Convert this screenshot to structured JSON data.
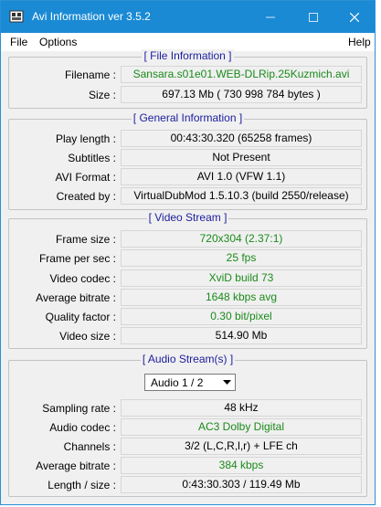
{
  "window": {
    "title": "Avi Information ver 3.5.2"
  },
  "menu": {
    "file": "File",
    "options": "Options",
    "help": "Help"
  },
  "file_info": {
    "title": "[ File Information ]",
    "rows": [
      {
        "label": "Filename :",
        "value": "Sansara.s01e01.WEB-DLRip.25Kuzmich.avi"
      },
      {
        "label": "Size :",
        "value": "697.13 Mb ( 730 998 784 bytes )"
      }
    ]
  },
  "general_info": {
    "title": "[ General Information ]",
    "rows": [
      {
        "label": "Play length :",
        "value": "00:43:30.320 (65258 frames)"
      },
      {
        "label": "Subtitles :",
        "value": "Not Present"
      },
      {
        "label": "AVI Format :",
        "value": "AVI 1.0 (VFW 1.1)"
      },
      {
        "label": "Created by :",
        "value": "VirtualDubMod 1.5.10.3 (build 2550/release)"
      }
    ]
  },
  "video_stream": {
    "title": "[ Video Stream ]",
    "rows": [
      {
        "label": "Frame size :",
        "value": "720x304 (2.37:1)"
      },
      {
        "label": "Frame per sec :",
        "value": "25 fps"
      },
      {
        "label": "Video codec :",
        "value": "XviD build 73"
      },
      {
        "label": "Average bitrate :",
        "value": "1648 kbps avg"
      },
      {
        "label": "Quality factor :",
        "value": "0.30 bit/pixel"
      },
      {
        "label": "Video size :",
        "value": "514.90 Mb"
      }
    ]
  },
  "audio_stream": {
    "title": "[ Audio Stream(s) ]",
    "selected": "Audio 1 / 2",
    "rows": [
      {
        "label": "Sampling rate :",
        "value": "48 kHz"
      },
      {
        "label": "Audio codec :",
        "value": "AC3 Dolby Digital"
      },
      {
        "label": "Channels :",
        "value": "3/2 (L,C,R,l,r) + LFE ch"
      },
      {
        "label": "Average bitrate :",
        "value": "384 kbps"
      },
      {
        "label": "Length / size :",
        "value": "0:43:30.303 / 119.49 Mb"
      }
    ]
  },
  "colors": {
    "title_bar": "#1a8ad4",
    "value_text_green": "#1a8a1a",
    "group_title": "#1c1ca0"
  }
}
